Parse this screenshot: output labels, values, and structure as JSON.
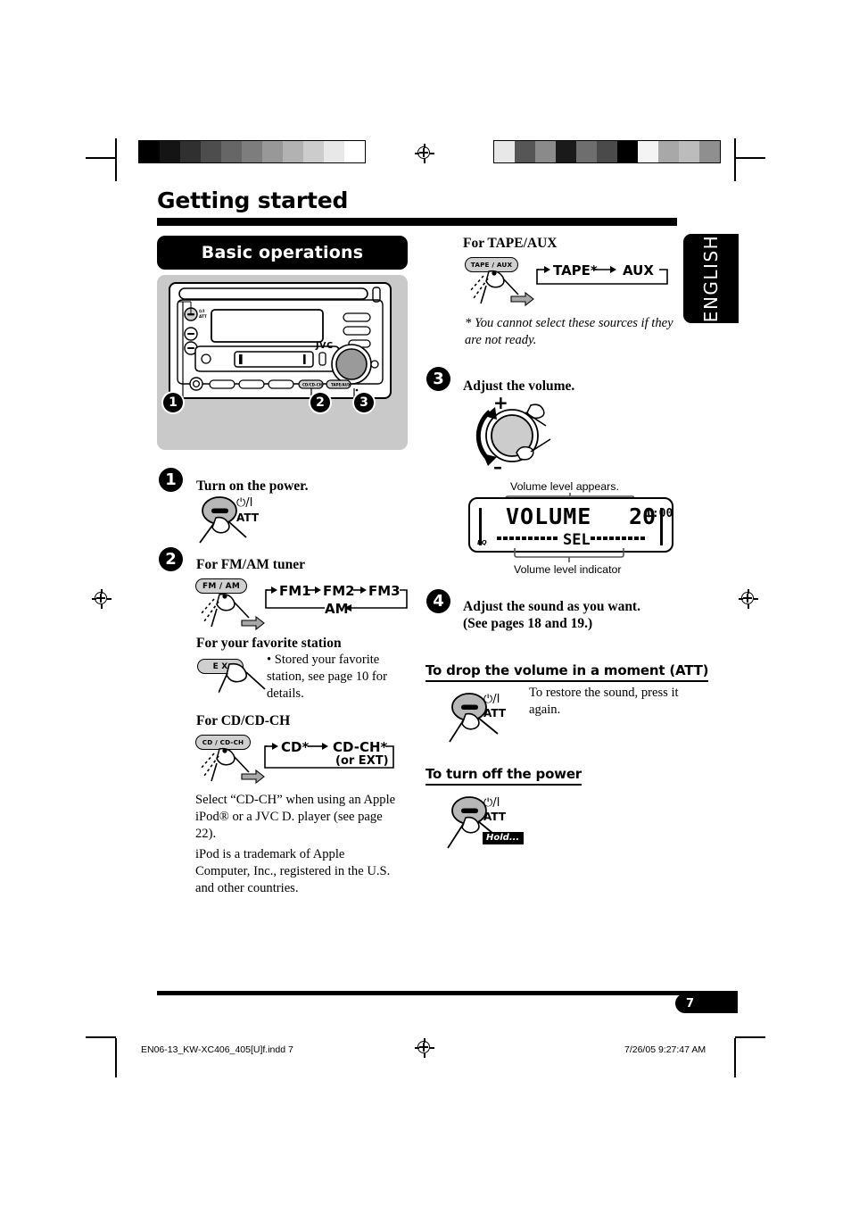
{
  "page": {
    "title": "Getting started",
    "section_title": "Basic operations",
    "language_tab": "ENGLISH",
    "page_number": "7"
  },
  "device": {
    "brand": "JVC",
    "callouts": [
      "1",
      "2",
      "3"
    ]
  },
  "steps": [
    {
      "number": "1",
      "heading": "Turn on the power.",
      "button_label_top": "⏻/I",
      "button_label_bottom": "ATT"
    },
    {
      "number": "2",
      "heading": "For FM/AM tuner"
    },
    {
      "number": "3",
      "heading": "Adjust the volume."
    },
    {
      "number": "4",
      "heading_line1": "Adjust the sound as you want.",
      "heading_line2": "(See pages 18 and 19.)"
    }
  ],
  "tuner": {
    "button": "FM / AM",
    "flow_top": [
      "FM1",
      "FM2",
      "FM3"
    ],
    "flow_bottom": "AM"
  },
  "favorite": {
    "heading": "For your favorite station",
    "button": "E X",
    "note": "• Stored your favorite station, see page 10 for details."
  },
  "cd": {
    "heading": "For CD/CD-CH",
    "button": "CD / CD-CH",
    "flow": [
      "CD*",
      "CD-CH*"
    ],
    "flow_sub": "(or EXT)",
    "paragraph1": "Select “CD-CH” when using an Apple iPod® or a JVC D. player (see page 22).",
    "paragraph2": "iPod is a trademark of Apple Computer, Inc., registered in the U.S. and other countries."
  },
  "tape_aux": {
    "heading": "For TAPE/AUX",
    "button": "TAPE / AUX",
    "flow": [
      "TAPE*",
      "AUX"
    ],
    "footnote": "* You cannot select these sources if they are not ready."
  },
  "volume": {
    "knob_plus": "+",
    "knob_minus": "–",
    "caption_top": "Volume level appears.",
    "caption_bottom": "Volume level indicator",
    "lcd": {
      "main_text": "VOLUME",
      "level": "20",
      "clock": "1:00",
      "sel": "SEL",
      "eq_indicator": "EQ"
    }
  },
  "att": {
    "heading": "To drop the volume in a moment (ATT)",
    "button_label_top": "⏻/I",
    "button_label_bottom": "ATT",
    "note": "To restore the sound, press it again."
  },
  "power_off": {
    "heading": "To turn off the power",
    "button_label_top": "⏻/I",
    "button_label_bottom": "ATT",
    "hold_tag": "Hold..."
  },
  "print_footer": {
    "filename": "EN06-13_KW-XC406_405[U]f.indd   7",
    "timestamp": "7/26/05   9:27:47 AM"
  },
  "colorbars": {
    "left": [
      "#000000",
      "#141414",
      "#303030",
      "#4d4d4d",
      "#666666",
      "#7d7d7d",
      "#989898",
      "#b2b2b2",
      "#cccccc",
      "#e8e8e8",
      "#ffffff"
    ],
    "right": [
      "#e8e8e8",
      "#565656",
      "#8a8a8a",
      "#1a1a1a",
      "#6e6e6e",
      "#4a4a4a",
      "#000000",
      "#f4f4f4",
      "#a8a8a8",
      "#bcbcbc",
      "#8f8f8f"
    ]
  }
}
